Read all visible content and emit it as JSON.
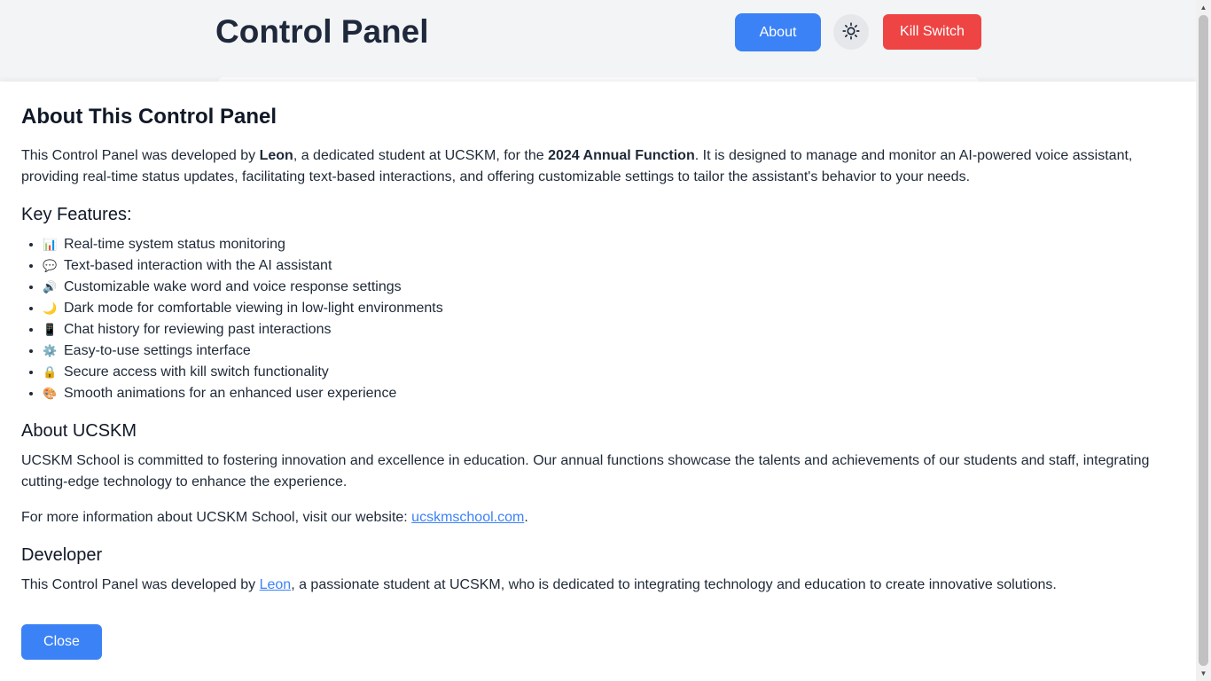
{
  "header": {
    "title": "Control Panel",
    "about_label": "About",
    "theme_icon": "sun-icon",
    "kill_label": "Kill Switch"
  },
  "modal": {
    "title": "About This Control Panel",
    "intro": {
      "p1": "This Control Panel was developed by ",
      "name": "Leon",
      "p2": ", a dedicated student at UCSKM, for the ",
      "event": "2024 Annual Function",
      "p3": ". It is designed to manage and monitor an AI-powered voice assistant, providing real-time status updates, facilitating text-based interactions, and offering customizable settings to tailor the assistant's behavior to your needs."
    },
    "features_heading": "Key Features:",
    "features": [
      {
        "icon": "📊",
        "text": "Real-time system status monitoring"
      },
      {
        "icon": "💬",
        "text": "Text-based interaction with the AI assistant"
      },
      {
        "icon": "🔊",
        "text": "Customizable wake word and voice response settings"
      },
      {
        "icon": "🌙",
        "text": "Dark mode for comfortable viewing in low-light environments"
      },
      {
        "icon": "📱",
        "text": "Chat history for reviewing past interactions"
      },
      {
        "icon": "⚙️",
        "text": "Easy-to-use settings interface"
      },
      {
        "icon": "🔒",
        "text": "Secure access with kill switch functionality"
      },
      {
        "icon": "🎨",
        "text": "Smooth animations for an enhanced user experience"
      }
    ],
    "ucskm_heading": "About UCSKM",
    "ucskm_text": "UCSKM School is committed to fostering innovation and excellence in education. Our annual functions showcase the talents and achievements of our students and staff, integrating cutting-edge technology to enhance the experience.",
    "more_info_prefix": "For more information about UCSKM School, visit our website: ",
    "website_link": "ucskmschool.com",
    "more_info_suffix": ".",
    "developer_heading": "Developer",
    "developer_prefix": "This Control Panel was developed by ",
    "developer_link": "Leon",
    "developer_suffix": ", a passionate student at UCSKM, who is dedicated to integrating technology and education to create innovative solutions.",
    "close_label": "Close"
  },
  "colors": {
    "accent": "#3b82f6",
    "danger": "#ef4444",
    "background": "#f3f4f6"
  }
}
